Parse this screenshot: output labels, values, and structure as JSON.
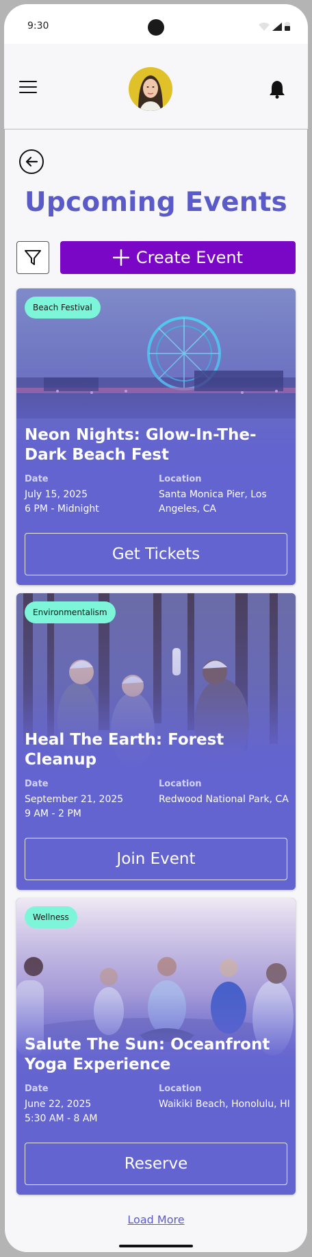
{
  "status": {
    "time": "9:30"
  },
  "header": {
    "avatar_alt": "profile avatar"
  },
  "page": {
    "title": "Upcoming Events",
    "create_label": "Create Event",
    "load_more": "Load More"
  },
  "events": [
    {
      "tag": "Beach Festival",
      "title": "Neon Nights: Glow-In-The-Dark Beach Fest",
      "date_label": "Date",
      "date": "July 15, 2025",
      "time": "6 PM - Midnight",
      "location_label": "Location",
      "location": "Santa Monica Pier, Los Angeles, CA",
      "cta": "Get Tickets"
    },
    {
      "tag": "Environmentalism",
      "title": "Heal The Earth: Forest Cleanup",
      "date_label": "Date",
      "date": "September 21, 2025",
      "time": "9 AM - 2 PM",
      "location_label": "Location",
      "location": "Redwood National Park, CA",
      "cta": "Join Event"
    },
    {
      "tag": "Wellness",
      "title": "Salute The Sun: Oceanfront Yoga Experience",
      "date_label": "Date",
      "date": "June 22, 2025",
      "time": "5:30 AM - 8 AM",
      "location_label": "Location",
      "location": "Waikiki Beach, Honolulu, HI",
      "cta": "Reserve"
    }
  ],
  "colors": {
    "accent": "#5a5bc9",
    "create_button": "#7a07c6",
    "badge": "#7cf5d8",
    "card": "#6464d0"
  },
  "icons": [
    "menu-icon",
    "bell-icon",
    "back-arrow-icon",
    "filter-icon",
    "plus-icon",
    "wifi-icon",
    "signal-icon",
    "battery-icon"
  ]
}
